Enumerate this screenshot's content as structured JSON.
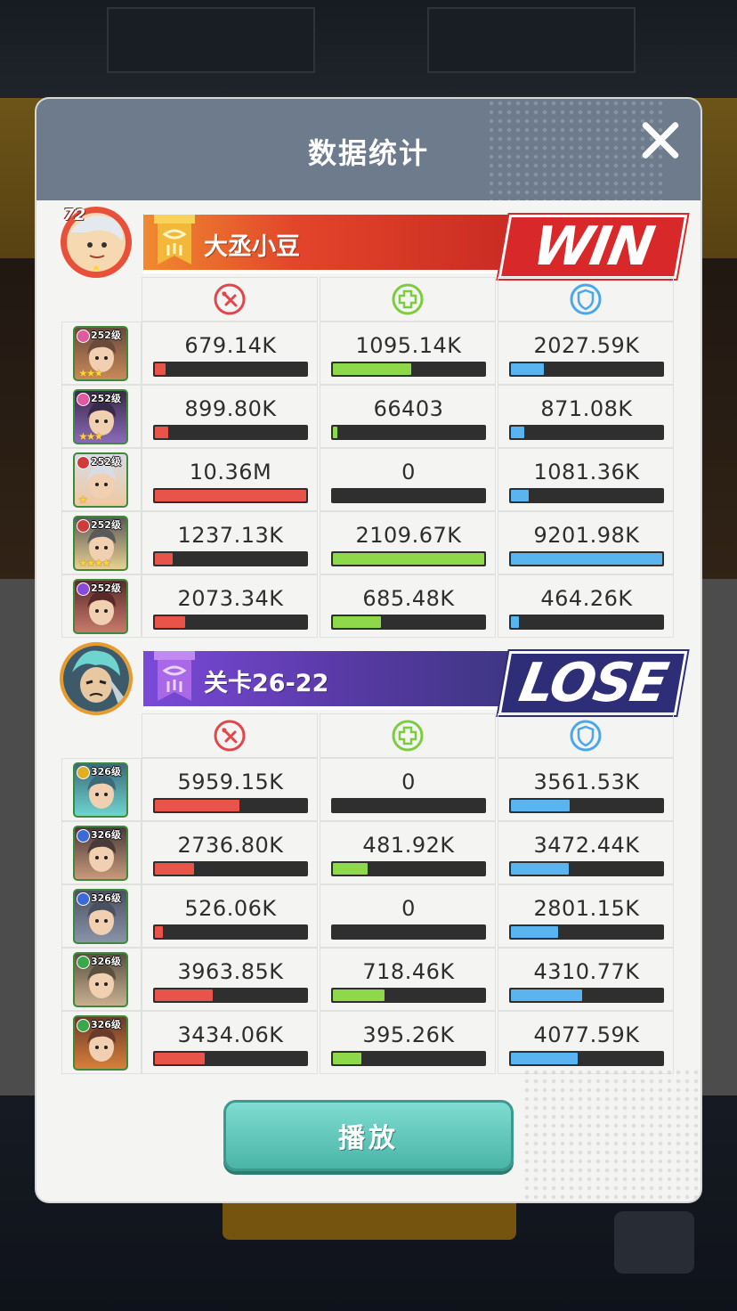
{
  "title": "数据统计",
  "close_icon": "close-icon",
  "play_button_label": "播放",
  "colors": {
    "damage": "#e8544a",
    "heal": "#8ed94a",
    "tank": "#5ab4f0",
    "win": "#d9282a",
    "lose": "#2e2e78"
  },
  "stat_icons": [
    "damage-icon",
    "heal-icon",
    "shield-icon"
  ],
  "teams": [
    {
      "name": "大丞小豆",
      "result": "WIN",
      "leader_level": "72",
      "heroes": [
        {
          "level": "252级",
          "element_color": "#e05aa0",
          "stars": "★★★",
          "damage": "679.14K",
          "damage_pct": 0.07,
          "heal": "1095.14K",
          "heal_pct": 0.52,
          "tank": "2027.59K",
          "tank_pct": 0.22
        },
        {
          "level": "252级",
          "element_color": "#e05aa0",
          "stars": "★★★",
          "damage": "899.80K",
          "damage_pct": 0.09,
          "heal": "66403",
          "heal_pct": 0.03,
          "tank": "871.08K",
          "tank_pct": 0.09
        },
        {
          "level": "252级",
          "element_color": "#d03a3a",
          "stars": "★",
          "damage": "10.36M",
          "damage_pct": 1.0,
          "heal": "0",
          "heal_pct": 0.0,
          "tank": "1081.36K",
          "tank_pct": 0.12
        },
        {
          "level": "252级",
          "element_color": "#d03a3a",
          "stars": "★★★★",
          "damage": "1237.13K",
          "damage_pct": 0.12,
          "heal": "2109.67K",
          "heal_pct": 1.0,
          "tank": "9201.98K",
          "tank_pct": 1.0
        },
        {
          "level": "252级",
          "element_color": "#8a4ad8",
          "stars": "",
          "damage": "2073.34K",
          "damage_pct": 0.2,
          "heal": "685.48K",
          "heal_pct": 0.32,
          "tank": "464.26K",
          "tank_pct": 0.05
        }
      ]
    },
    {
      "name": "关卡26-22",
      "result": "LOSE",
      "leader_level": "",
      "heroes": [
        {
          "level": "326级",
          "element_color": "#e0b020",
          "stars": "",
          "damage": "5959.15K",
          "damage_pct": 0.56,
          "heal": "0",
          "heal_pct": 0.0,
          "tank": "3561.53K",
          "tank_pct": 0.39
        },
        {
          "level": "326级",
          "element_color": "#3a6ad8",
          "stars": "",
          "damage": "2736.80K",
          "damage_pct": 0.26,
          "heal": "481.92K",
          "heal_pct": 0.23,
          "tank": "3472.44K",
          "tank_pct": 0.38
        },
        {
          "level": "326级",
          "element_color": "#3a6ad8",
          "stars": "",
          "damage": "526.06K",
          "damage_pct": 0.05,
          "heal": "0",
          "heal_pct": 0.0,
          "tank": "2801.15K",
          "tank_pct": 0.31
        },
        {
          "level": "326级",
          "element_color": "#3aa84a",
          "stars": "",
          "damage": "3963.85K",
          "damage_pct": 0.38,
          "heal": "718.46K",
          "heal_pct": 0.34,
          "tank": "4310.77K",
          "tank_pct": 0.47
        },
        {
          "level": "326级",
          "element_color": "#3aa84a",
          "stars": "",
          "damage": "3434.06K",
          "damage_pct": 0.33,
          "heal": "395.26K",
          "heal_pct": 0.19,
          "tank": "4077.59K",
          "tank_pct": 0.44
        }
      ]
    }
  ]
}
